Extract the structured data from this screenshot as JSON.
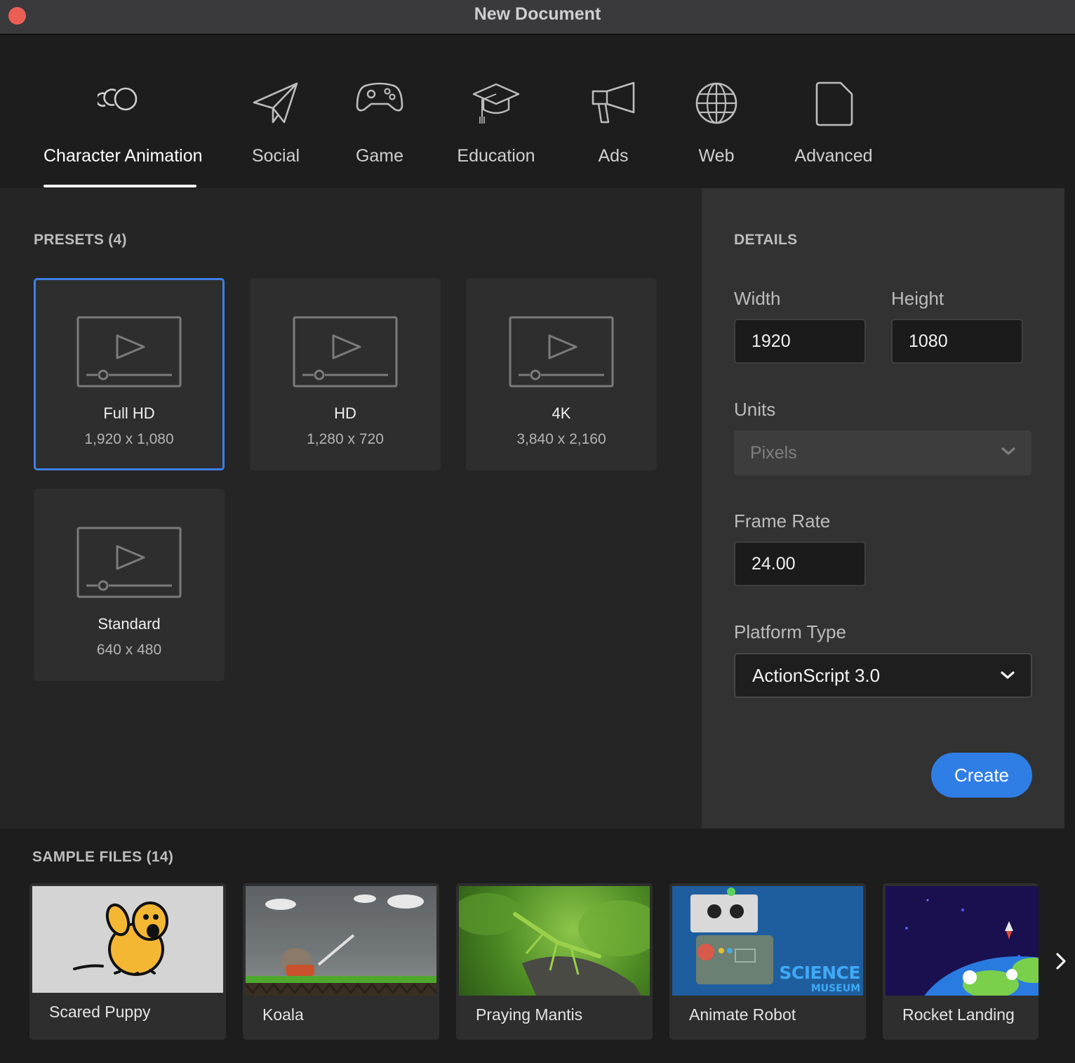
{
  "window": {
    "title": "New Document"
  },
  "categories": [
    {
      "label": "Character Animation",
      "icon": "character-animation-icon",
      "active": true
    },
    {
      "label": "Social",
      "icon": "paper-plane-icon"
    },
    {
      "label": "Game",
      "icon": "gamepad-icon"
    },
    {
      "label": "Education",
      "icon": "graduation-cap-icon"
    },
    {
      "label": "Ads",
      "icon": "megaphone-icon"
    },
    {
      "label": "Web",
      "icon": "globe-icon"
    },
    {
      "label": "Advanced",
      "icon": "document-icon"
    }
  ],
  "presets": {
    "heading": "PRESETS (4)",
    "items": [
      {
        "name": "Full HD",
        "size": "1,920 x 1,080",
        "selected": true
      },
      {
        "name": "HD",
        "size": "1,280 x 720"
      },
      {
        "name": "4K",
        "size": "3,840 x 2,160"
      },
      {
        "name": "Standard",
        "size": "640 x 480"
      }
    ]
  },
  "details": {
    "heading": "DETAILS",
    "width_label": "Width",
    "width_value": "1920",
    "height_label": "Height",
    "height_value": "1080",
    "units_label": "Units",
    "units_value": "Pixels",
    "frame_rate_label": "Frame Rate",
    "frame_rate_value": "24.00",
    "platform_label": "Platform Type",
    "platform_value": "ActionScript 3.0",
    "create_label": "Create"
  },
  "samples": {
    "heading": "SAMPLE FILES (14)",
    "items": [
      {
        "name": "Scared Puppy"
      },
      {
        "name": "Koala"
      },
      {
        "name": "Praying Mantis"
      },
      {
        "name": "Animate Robot",
        "logo_text": "SCIENCE",
        "logo_sub": "MUSEUM"
      },
      {
        "name": "Rocket Landing"
      }
    ]
  },
  "colors": {
    "accent": "#2f7ee6",
    "selection_border": "#3e7fe6",
    "close_button": "#ec5f57",
    "panel_bg": "#252525",
    "details_bg": "#323232"
  }
}
